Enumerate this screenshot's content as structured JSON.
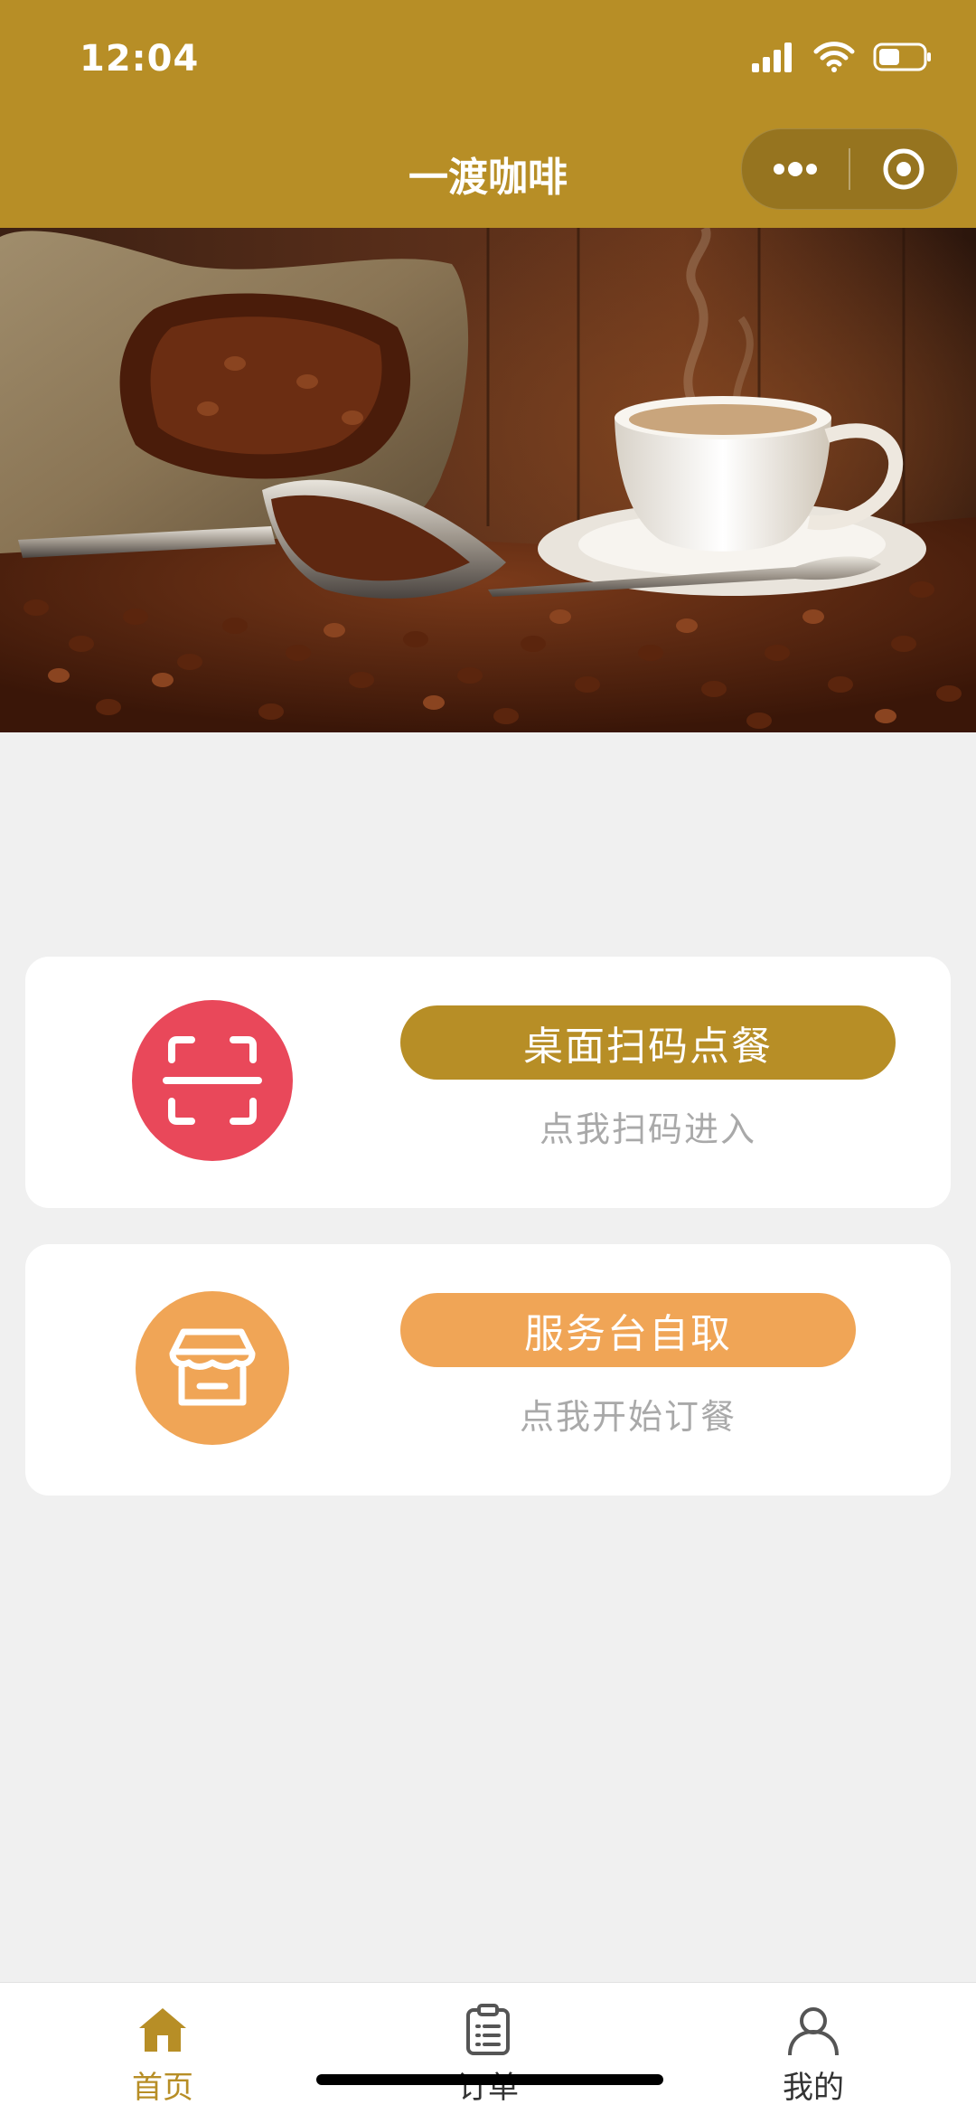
{
  "status_bar": {
    "time": "12:04"
  },
  "nav": {
    "title": "一渡咖啡"
  },
  "cards": [
    {
      "button_label": "桌面扫码点餐",
      "subtitle": "点我扫码进入",
      "icon": "scan-icon",
      "color": "#e9485a",
      "button_color": "#b78e26"
    },
    {
      "button_label": "服务台自取",
      "subtitle": "点我开始订餐",
      "icon": "store-icon",
      "color": "#f0a556",
      "button_color": "#f0a556"
    }
  ],
  "tabbar": {
    "items": [
      {
        "label": "首页",
        "icon": "home-icon",
        "active": true
      },
      {
        "label": "订单",
        "icon": "clipboard-icon",
        "active": false
      },
      {
        "label": "我的",
        "icon": "user-icon",
        "active": false
      }
    ]
  },
  "colors": {
    "accent": "#b78e26",
    "background": "#f0f0f0"
  }
}
